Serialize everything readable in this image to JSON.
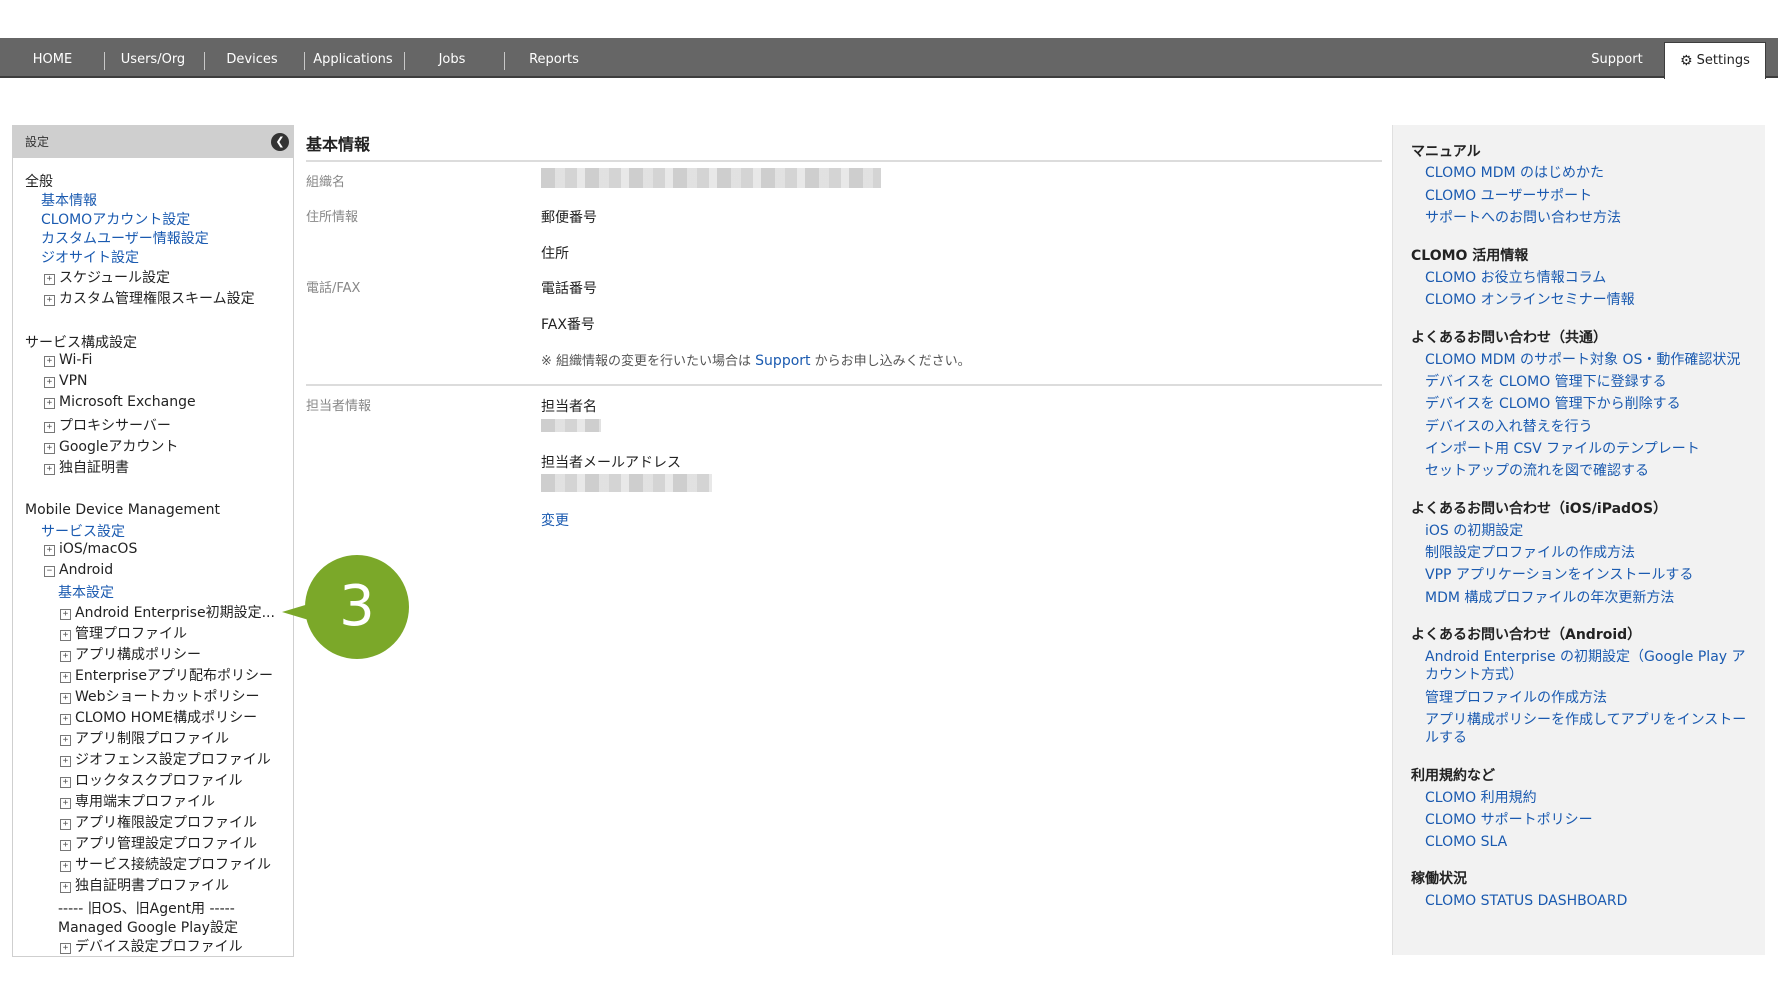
{
  "nav": {
    "items": [
      "HOME",
      "Users/Org",
      "Devices",
      "Applications",
      "Jobs",
      "Reports"
    ],
    "support": "Support",
    "settings": "Settings"
  },
  "sidebar": {
    "header": "設定",
    "general": {
      "heading": "全般",
      "links": [
        "基本情報",
        "CLOMOアカウント設定",
        "カスタムユーザー情報設定",
        "ジオサイト設定"
      ],
      "expandables": [
        "スケジュール設定",
        "カスタム管理権限スキーム設定"
      ]
    },
    "service": {
      "heading": "サービス構成設定",
      "items": [
        "Wi-Fi",
        "VPN",
        "Microsoft Exchange",
        "プロキシサーバー",
        "Googleアカウント",
        "独自証明書"
      ]
    },
    "mdm": {
      "heading": "Mobile Device Management",
      "service_link": "サービス設定",
      "ios": "iOS/macOS",
      "android": "Android",
      "android_basic": "基本設定",
      "android_items": [
        "Android Enterprise初期設定...",
        "管理プロファイル",
        "アプリ構成ポリシー",
        "Enterpriseアプリ配布ポリシー",
        "Webショートカットポリシー",
        "CLOMO HOME構成ポリシー",
        "アプリ制限プロファイル",
        "ジオフェンス設定プロファイル",
        "ロックタスクプロファイル",
        "専用端末プロファイル",
        "アプリ権限設定プロファイル",
        "アプリ管理設定プロファイル",
        "サービス接続設定プロファイル",
        "独自証明書プロファイル"
      ],
      "legacy_divider": "----- 旧OS、旧Agent用 -----",
      "managed_play": "Managed Google Play設定",
      "device_profile": "デバイス設定プロファイル"
    }
  },
  "badge": "3",
  "main": {
    "title": "基本情報",
    "org_label": "組織名",
    "address_label": "住所情報",
    "postal_label": "郵便番号",
    "address_field": "住所",
    "phone_label": "電話/FAX",
    "phone_field": "電話番号",
    "fax_field": "FAX番号",
    "note_prefix": "※ 組織情報の変更を行いたい場合は",
    "note_link": "Support",
    "note_suffix": "からお申し込みください。",
    "contact_label": "担当者情報",
    "contact_name_field": "担当者名",
    "contact_email_field": "担当者メールアドレス",
    "change_link": "変更"
  },
  "right": {
    "sections": [
      {
        "heading": "マニュアル",
        "links": [
          "CLOMO MDM のはじめかた",
          "CLOMO ユーザーサポート",
          "サポートへのお問い合わせ方法"
        ]
      },
      {
        "heading": "CLOMO 活用情報",
        "links": [
          "CLOMO お役立ち情報コラム",
          "CLOMO オンラインセミナー情報"
        ]
      },
      {
        "heading": "よくあるお問い合わせ（共通）",
        "links": [
          "CLOMO MDM のサポート対象 OS・動作確認状況",
          "デバイスを CLOMO 管理下に登録する",
          "デバイスを CLOMO 管理下から削除する",
          "デバイスの入れ替えを行う",
          "インポート用 CSV ファイルのテンプレート",
          "セットアップの流れを図で確認する"
        ]
      },
      {
        "heading": "よくあるお問い合わせ（iOS/iPadOS）",
        "links": [
          "iOS の初期設定",
          "制限設定プロファイルの作成方法",
          "VPP アプリケーションをインストールする",
          "MDM 構成プロファイルの年次更新方法"
        ]
      },
      {
        "heading": "よくあるお問い合わせ（Android）",
        "links": [
          "Android Enterprise の初期設定（Google Play ア",
          "カウント方式）",
          "管理プロファイルの作成方法",
          "アプリ構成ポリシーを作成してアプリをインストー",
          "ルする"
        ]
      },
      {
        "heading": "利用規約など",
        "links": [
          "CLOMO 利用規約",
          "CLOMO サポートポリシー",
          "CLOMO SLA"
        ]
      },
      {
        "heading": "稼働状況",
        "links": [
          "CLOMO STATUS DASHBOARD"
        ]
      }
    ]
  }
}
